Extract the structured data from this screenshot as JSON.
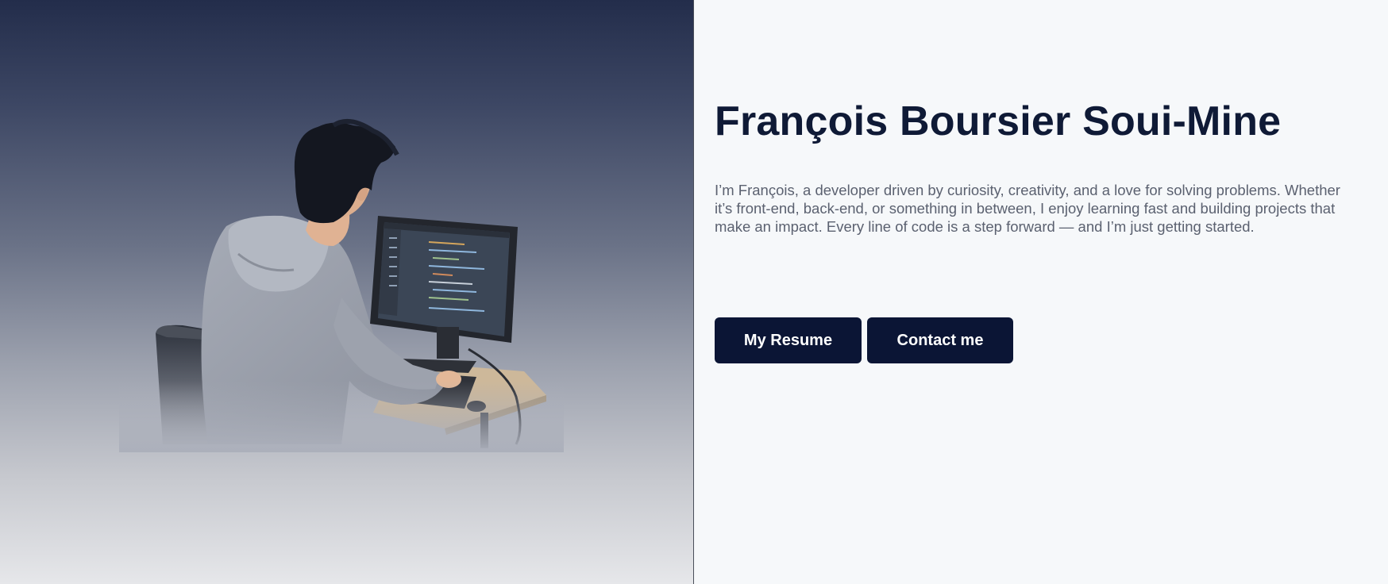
{
  "profile": {
    "name": "François Boursier Soui-Mine",
    "intro": "I’m François, a developer driven by curiosity, creativity, and a love for solving problems. Whether it’s front-end, back-end, or something in between, I enjoy learning fast and building projects that make an impact. Every line of code is a step forward — and I’m just getting started."
  },
  "actions": {
    "resume_label": "My Resume",
    "contact_label": "Contact me"
  },
  "illustration": {
    "subject": "developer-at-computer-illustration"
  },
  "colors": {
    "primary": "#0b1535",
    "heading": "#0f1a36",
    "body_text": "#5b6170",
    "background": "#f6f8fa"
  }
}
